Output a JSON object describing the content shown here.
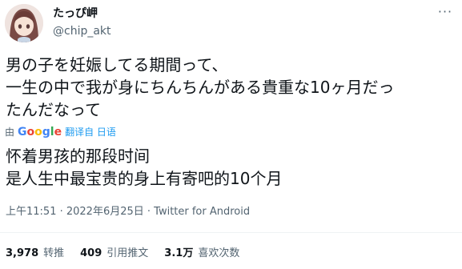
{
  "author": {
    "display_name": "たっぴ岬",
    "handle": "@chip_akt",
    "avatar_icon": "anime-girl-avatar-icon"
  },
  "tweet": {
    "text_lines": [
      "男の子を妊娠してる期間って、",
      "一生の中で我が身にちんちんがある貴重な10ヶ月だっ",
      "たんだなって"
    ],
    "translation": {
      "by_label": "由",
      "provider": "Google",
      "link_label": "翻译自 日语",
      "lines": [
        "怀着男孩的那段时间",
        "是人生中最宝贵的身上有寄吧的10个月"
      ]
    },
    "meta": "上午11:51 · 2022年6月25日 · Twitter for Android"
  },
  "stats": [
    {
      "count": "3,978",
      "label": "转推"
    },
    {
      "count": "409",
      "label": "引用推文"
    },
    {
      "count": "3.1万",
      "label": "喜欢次数"
    }
  ],
  "colors": {
    "text": "#0f1419",
    "secondary": "#536471",
    "link": "#1d9bf0",
    "divider": "#eff3f4"
  }
}
